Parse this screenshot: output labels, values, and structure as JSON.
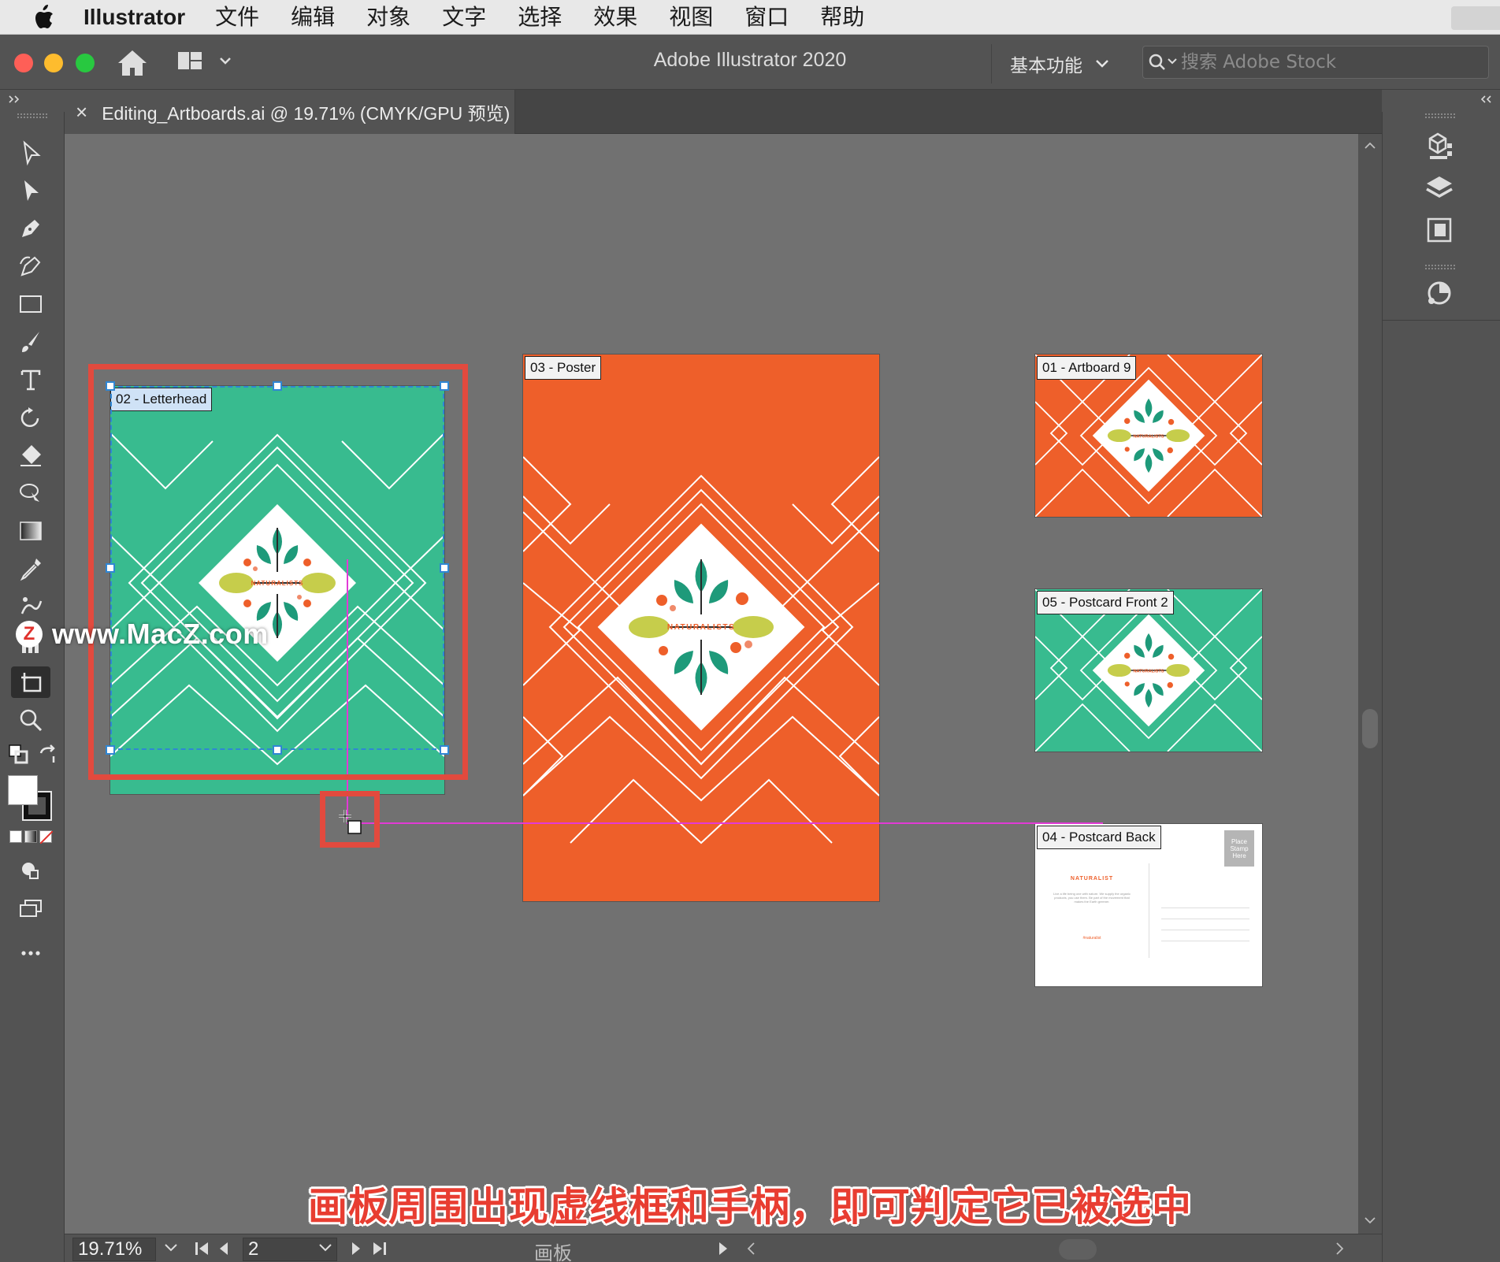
{
  "menubar": {
    "app_name": "Illustrator",
    "items": [
      "文件",
      "编辑",
      "对象",
      "文字",
      "选择",
      "效果",
      "视图",
      "窗口",
      "帮助"
    ]
  },
  "titlebar": {
    "title": "Adobe Illustrator 2020",
    "workspace": "基本功能",
    "search_placeholder": "搜索 Adobe Stock"
  },
  "document_tab": {
    "close": "×",
    "label": "Editing_Artboards.ai @ 19.71% (CMYK/GPU 预览)"
  },
  "artboards": [
    {
      "label": "02 - Letterhead",
      "color": "#38bb8f",
      "selected": true
    },
    {
      "label": "03 - Poster",
      "color": "#ee5f2a",
      "selected": false
    },
    {
      "label": "01 - Artboard 9",
      "color": "#ee5f2a",
      "selected": false
    },
    {
      "label": "05 - Postcard Front 2",
      "color": "#38bb8f",
      "selected": false
    },
    {
      "label": "04 - Postcard Back",
      "color": "#ffffff",
      "selected": false
    }
  ],
  "logo_text": "NATURALISTS",
  "postcard_back": {
    "brand": "NATURALIST",
    "stamp": "Place Stamp Here",
    "body": "Live a life being one with nature. We supply the organic products, you use them. Be part of the movement that makes the Earth greener.",
    "hashtag": "#naturalist"
  },
  "statusbar": {
    "zoom": "19.71%",
    "artboard_number": "2",
    "panel_label": "画板"
  },
  "watermark": {
    "logo": "Z",
    "text": "www.MacZ.com"
  },
  "caption": "画板周围出现虚线框和手柄，即可判定它已被选中",
  "colors": {
    "teal": "#38bb8f",
    "orange": "#ee5f2a",
    "selection_red": "#e24a3e",
    "smart_guide": "#e23ad6"
  }
}
